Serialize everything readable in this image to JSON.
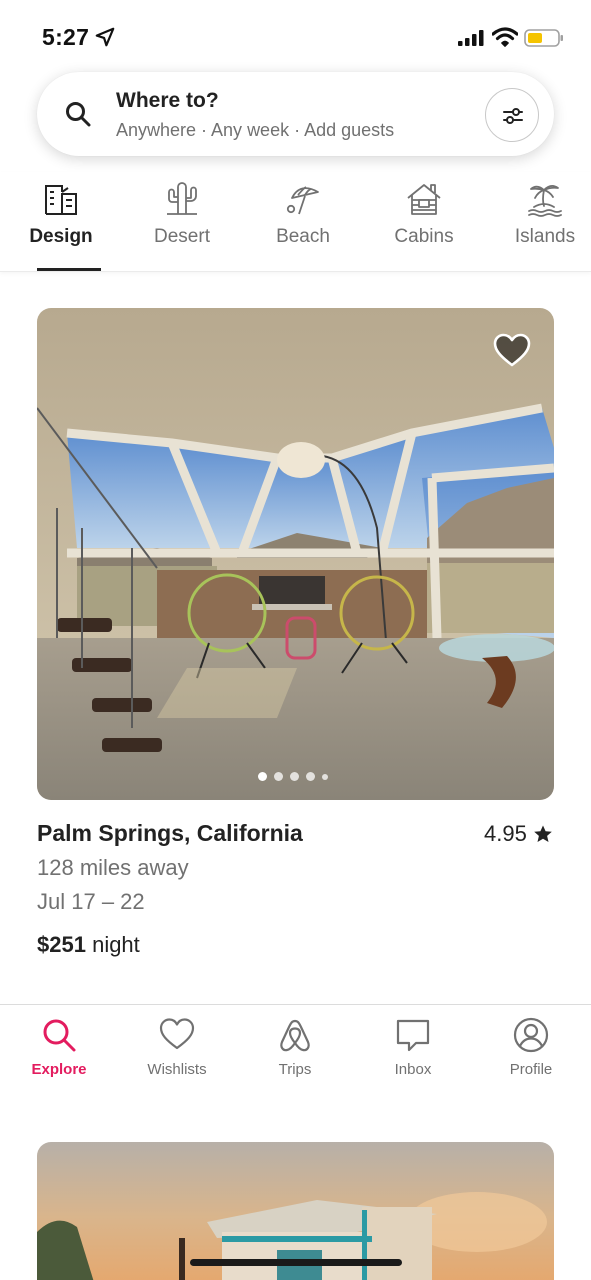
{
  "status_bar": {
    "time": "5:27",
    "battery_color": "#f5c400"
  },
  "search": {
    "title": "Where to?",
    "subtitle": "Anywhere · Any week · Add guests"
  },
  "categories": [
    {
      "label": "Design",
      "icon": "design-building-icon",
      "active": true
    },
    {
      "label": "Desert",
      "icon": "cactus-icon",
      "active": false
    },
    {
      "label": "Beach",
      "icon": "beach-umbrella-icon",
      "active": false
    },
    {
      "label": "Cabins",
      "icon": "cabin-icon",
      "active": false
    },
    {
      "label": "Islands",
      "icon": "island-palm-icon",
      "active": false
    }
  ],
  "listing": {
    "title": "Palm Springs, California",
    "rating": "4.95",
    "distance": "128 miles away",
    "dates": "Jul 17 – 22",
    "price": "$251",
    "price_unit": "night",
    "photo_count": 5,
    "active_photo": 1
  },
  "bottom_nav": [
    {
      "label": "Explore",
      "icon": "search-icon",
      "active": true
    },
    {
      "label": "Wishlists",
      "icon": "heart-icon",
      "active": false
    },
    {
      "label": "Trips",
      "icon": "airbnb-logo-icon",
      "active": false
    },
    {
      "label": "Inbox",
      "icon": "chat-bubble-icon",
      "active": false
    },
    {
      "label": "Profile",
      "icon": "profile-icon",
      "active": false
    }
  ],
  "colors": {
    "brand": "#e31c5f",
    "text_primary": "#222222",
    "text_secondary": "#717171"
  }
}
